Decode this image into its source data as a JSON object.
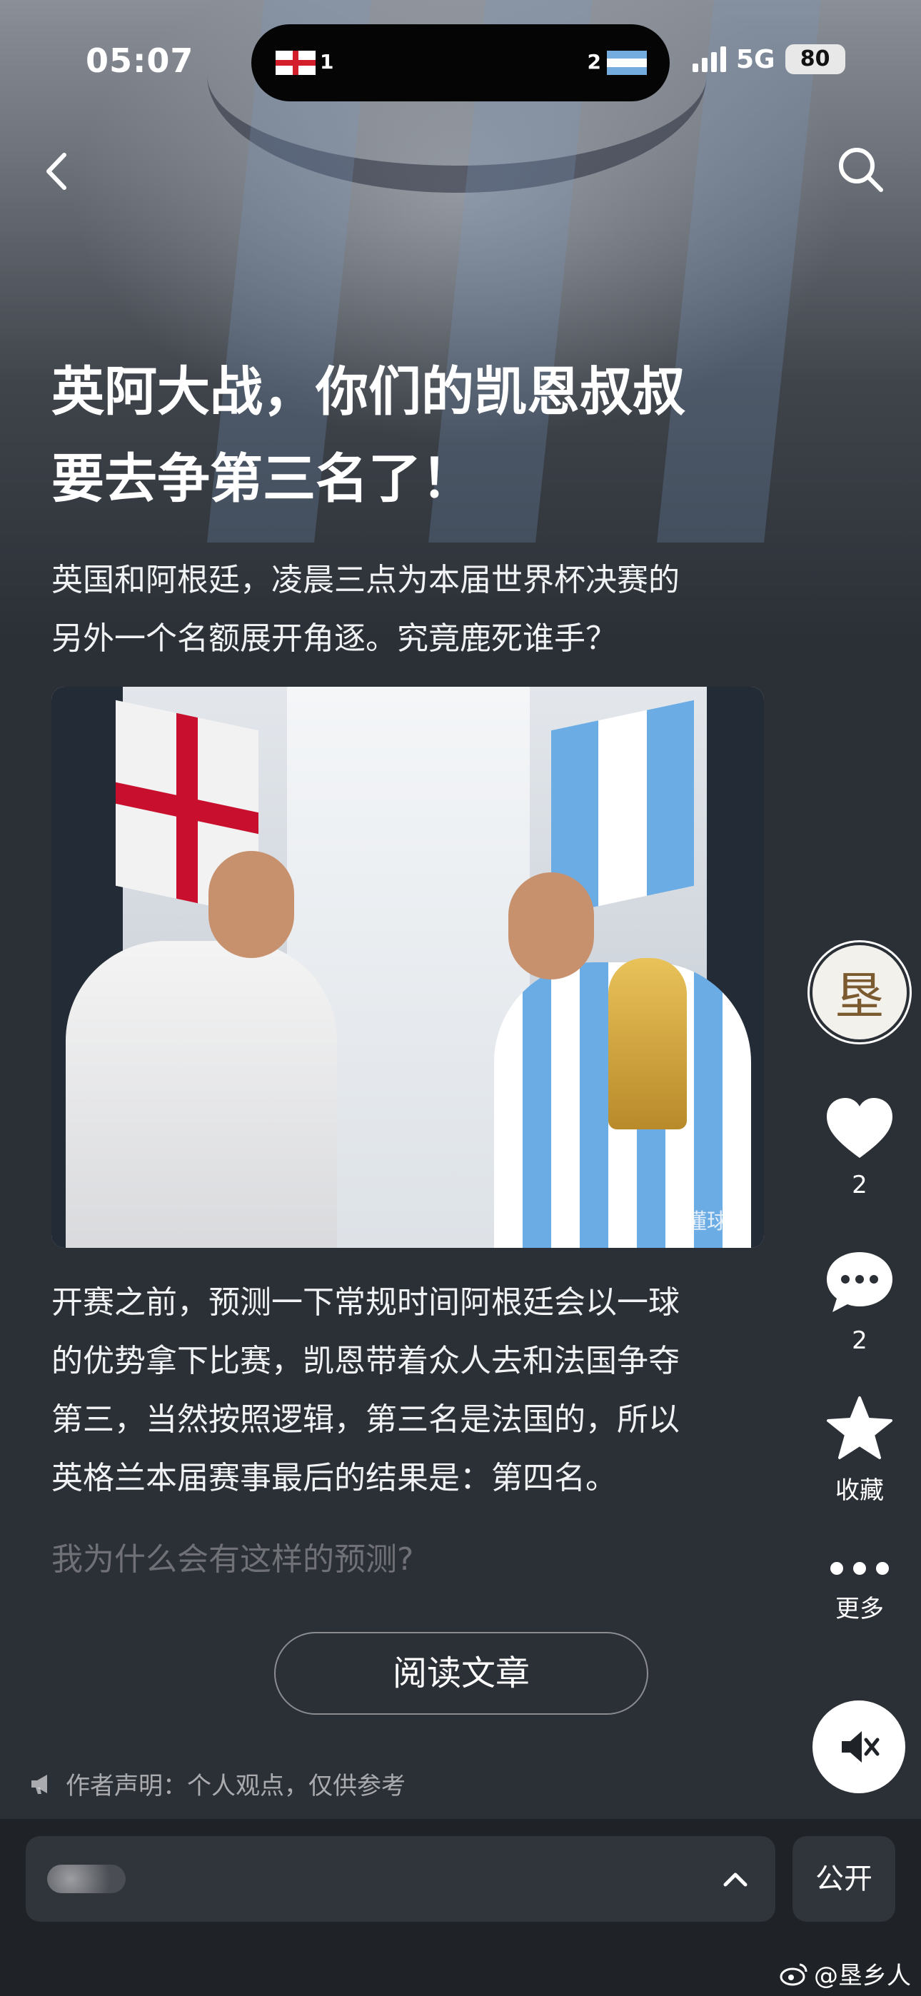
{
  "status_bar": {
    "time": "05:07",
    "score_england": "1",
    "score_argentina": "2",
    "network": "5G",
    "battery": "80"
  },
  "article": {
    "title_line1": "英阿大战，你们的凯恩叔叔",
    "title_line2": "要去争第三名了！",
    "summary_line1": "英国和阿根廷，凌晨三点为本届世界杯决赛的",
    "summary_line2": "另外一个名额展开角逐。究竟鹿死谁手？",
    "image_watermark": "懂球帝",
    "body_line1": "开赛之前，预测一下常规时间阿根廷会以一球",
    "body_line2": "的优势拿下比赛，凯恩带着众人去和法国争夺",
    "body_line3": "第三，当然按照逻辑，第三名是法国的，所以",
    "body_line4": "英格兰本届赛事最后的结果是：第四名。",
    "faded_line": "我为什么会有这样的预测?",
    "read_button": "阅读文章",
    "disclaimer": "作者声明：个人观点，仅供参考"
  },
  "actions": {
    "avatar_char": "垦",
    "like_count": "2",
    "comment_count": "2",
    "favorite_label": "收藏",
    "more_label": "更多"
  },
  "bottom": {
    "public_label": "公开",
    "weibo_handle": "@垦乡人"
  },
  "icons": {
    "back": "chevron-left-icon",
    "search": "search-icon",
    "like": "heart-icon",
    "comment": "comment-bubble-icon",
    "favorite": "star-icon",
    "more": "ellipsis-icon",
    "mute": "speaker-muted-icon"
  }
}
